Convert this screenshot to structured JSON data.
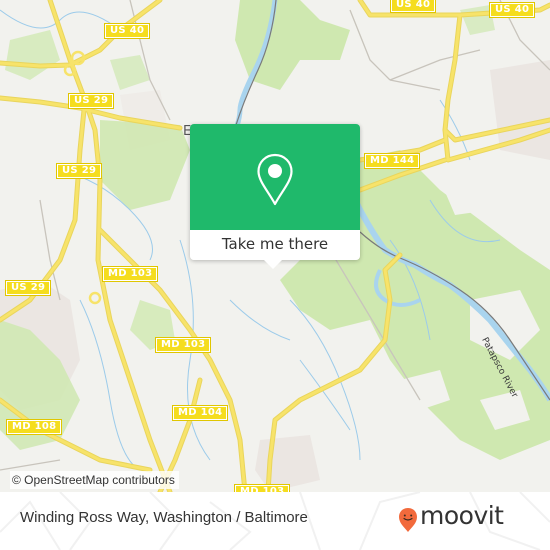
{
  "map": {
    "road_shields": [
      {
        "id": "us40-top-left",
        "label": "US 40"
      },
      {
        "id": "us40-top-mid",
        "label": "US 40"
      },
      {
        "id": "us40-top-right",
        "label": "US 40"
      },
      {
        "id": "us29-upper",
        "label": "US 29"
      },
      {
        "id": "us29-middle",
        "label": "US 29"
      },
      {
        "id": "us29-lower",
        "label": "US 29"
      },
      {
        "id": "md144",
        "label": "MD 144"
      },
      {
        "id": "md103-a",
        "label": "MD 103"
      },
      {
        "id": "md103-b",
        "label": "MD 103"
      },
      {
        "id": "md104",
        "label": "MD 104"
      },
      {
        "id": "md108",
        "label": "MD 108"
      },
      {
        "id": "md103-bottom",
        "label": "MD 103"
      }
    ],
    "town_label": "E",
    "river_label": "Patapsco River",
    "attribution": "© OpenStreetMap contributors",
    "colors": {
      "land": "#f2f2ee",
      "park": "#cfe8b0",
      "water": "#a9d4ee",
      "road_major": "#f7e36a",
      "road_minor": "#c8c4bc",
      "rail": "#7a7a7a",
      "urban": "#e8e0dc"
    }
  },
  "popup": {
    "icon": "map-pin-icon",
    "action_label": "Take me there",
    "color": "#1fb96b"
  },
  "footer": {
    "place_name": "Winding Ross Way, Washington / Baltimore",
    "brand_name": "moovit",
    "brand_icon": "moovit-smiley-pin-icon",
    "brand_color": "#f26a3c"
  }
}
